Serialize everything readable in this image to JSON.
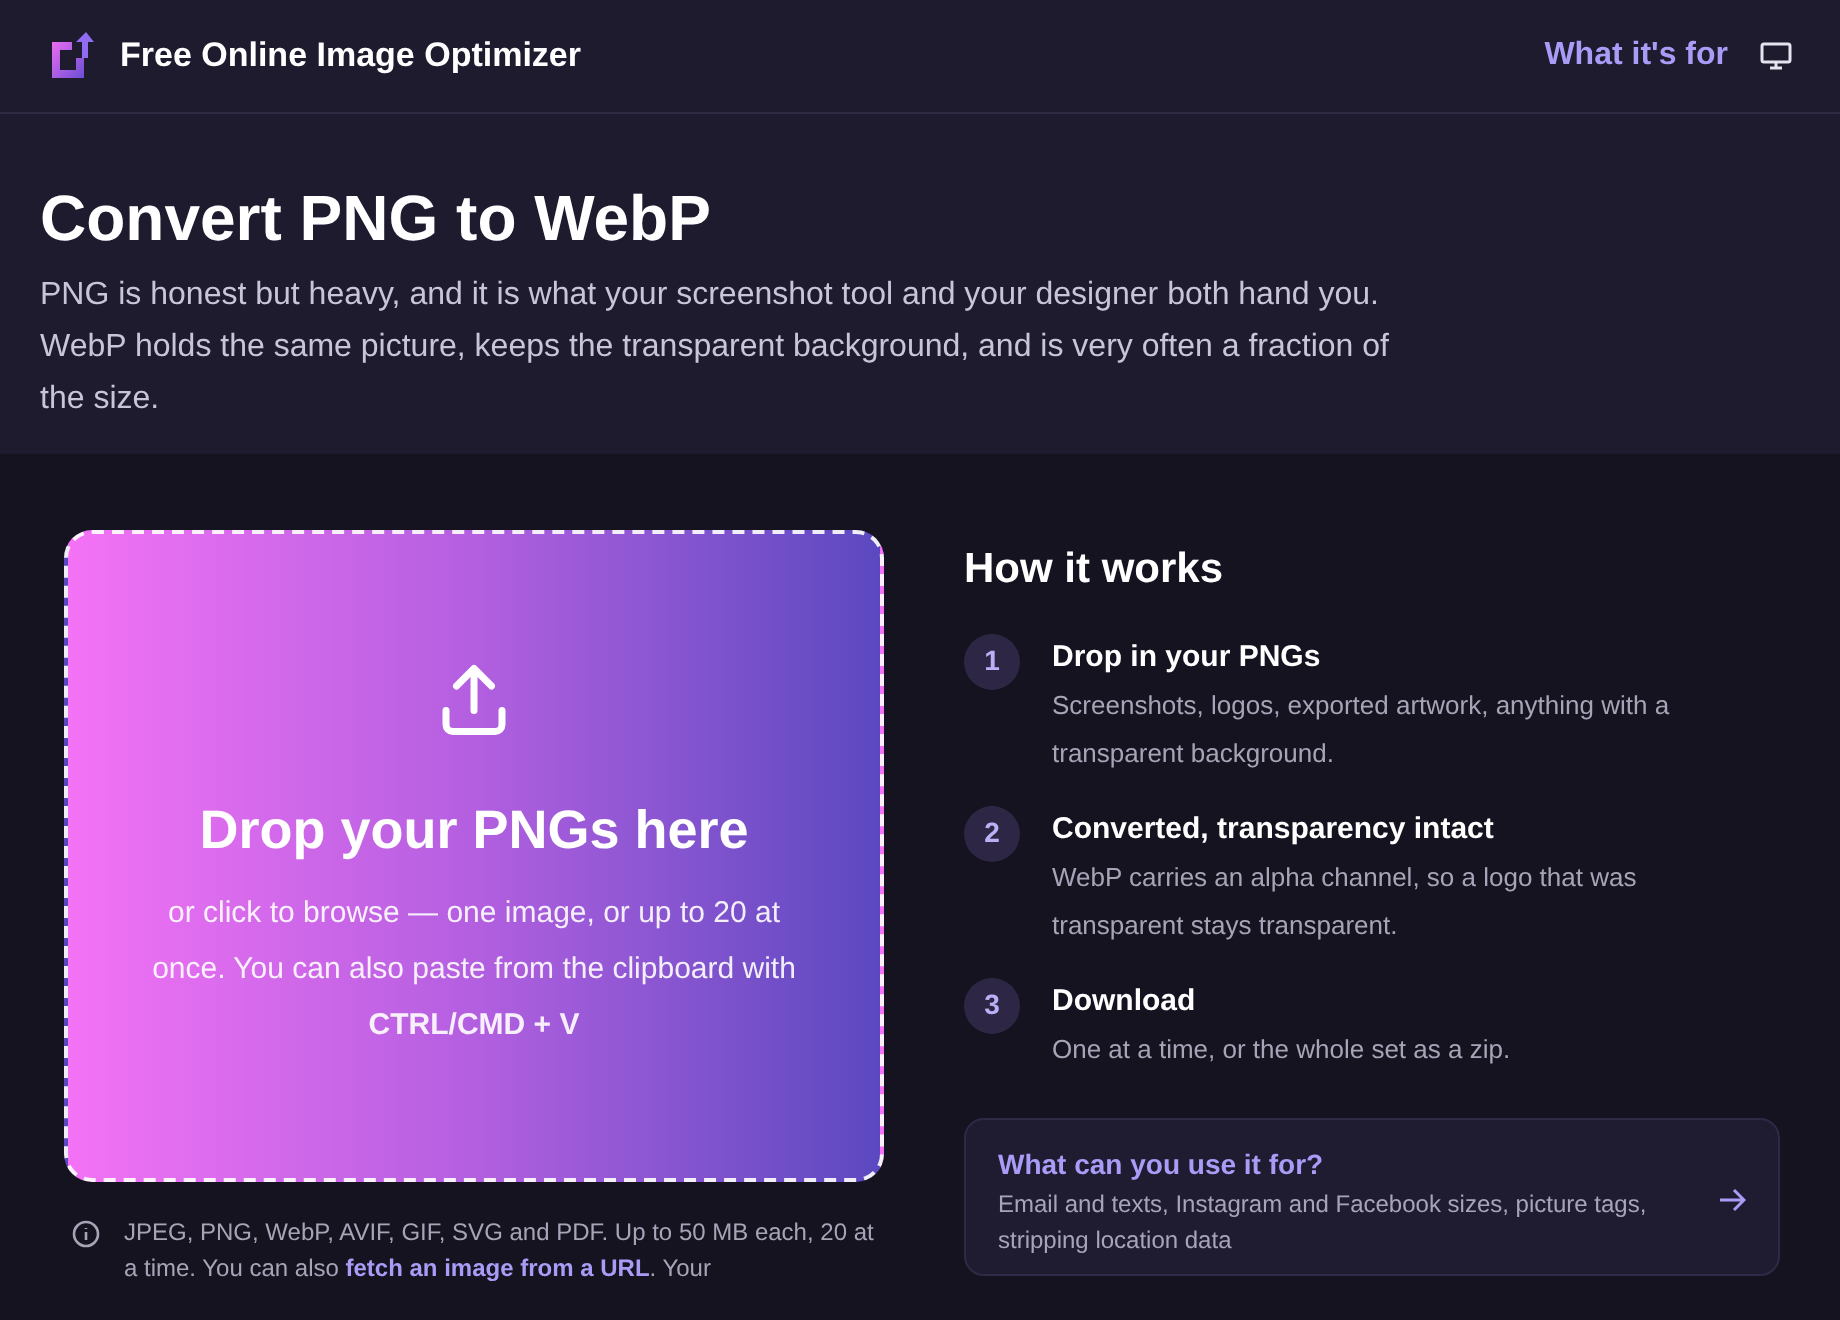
{
  "header": {
    "brand": "Free Online Image Optimizer",
    "nav_link": "What it's for"
  },
  "hero": {
    "title": "Convert PNG to WebP",
    "text": "PNG is honest but heavy, and it is what your screenshot tool and your designer both hand you. WebP holds the same picture, keeps the transparent background, and is very often a fraction of the size."
  },
  "dropzone": {
    "title": "Drop your PNGs here",
    "text": "or click to browse — one image, or up to 20 at once. You can also paste from the clipboard with **CTRL/CMD + V**"
  },
  "note": {
    "text_before": "JPEG, PNG, WebP, AVIF, GIF, SVG and PDF. Up to 50 MB each, 20 at a time. You can also ",
    "link": "fetch an image from a URL",
    "text_after": ". Your"
  },
  "how": {
    "title": "How it works",
    "steps": [
      {
        "number": "1",
        "title": "Drop in your PNGs",
        "text": "Screenshots, logos, exported artwork, anything with a transparent background."
      },
      {
        "number": "2",
        "title": "Converted, transparency intact",
        "text": "WebP carries an alpha channel, so a logo that was transparent stays transparent."
      },
      {
        "number": "3",
        "title": "Download",
        "text": "One at a time, or the whole set as a zip."
      }
    ]
  },
  "card": {
    "title": "What can you use it for?",
    "text": "Email and texts, Instagram and Facebook sizes, picture tags, stripping location data"
  }
}
